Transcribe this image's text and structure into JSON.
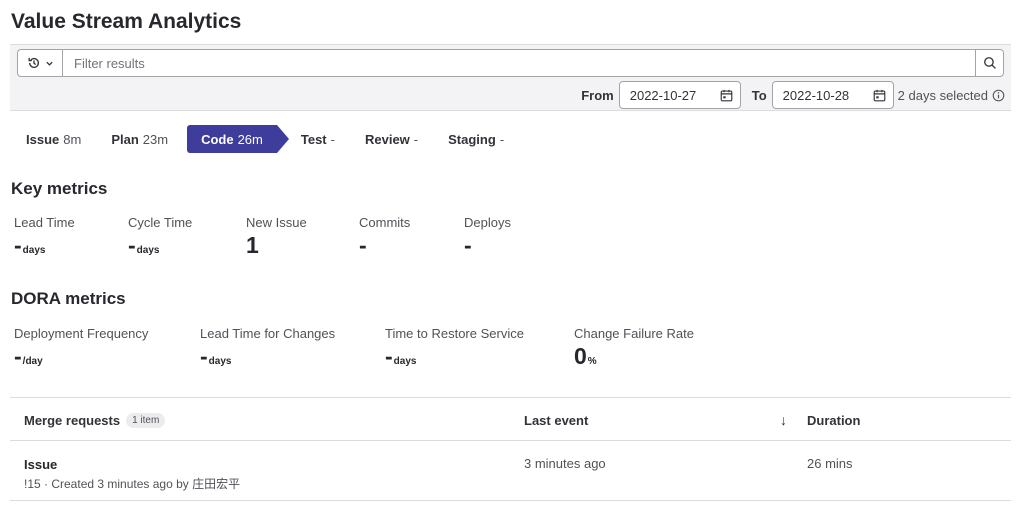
{
  "page": {
    "title": "Value Stream Analytics"
  },
  "filter": {
    "placeholder": "Filter results",
    "from_label": "From",
    "from_value": "2022-10-27",
    "to_label": "To",
    "to_value": "2022-10-28",
    "days_selected": "2 days selected"
  },
  "stages": [
    {
      "name": "Issue",
      "value": "8m"
    },
    {
      "name": "Plan",
      "value": "23m"
    },
    {
      "name": "Code",
      "value": "26m"
    },
    {
      "name": "Test",
      "value": "-"
    },
    {
      "name": "Review",
      "value": "-"
    },
    {
      "name": "Staging",
      "value": "-"
    }
  ],
  "key_metrics": {
    "title": "Key metrics",
    "items": [
      {
        "label": "Lead Time",
        "value": "-",
        "unit": "days"
      },
      {
        "label": "Cycle Time",
        "value": "-",
        "unit": "days"
      },
      {
        "label": "New Issue",
        "value": "1",
        "unit": ""
      },
      {
        "label": "Commits",
        "value": "-",
        "unit": ""
      },
      {
        "label": "Deploys",
        "value": "-",
        "unit": ""
      }
    ]
  },
  "dora_metrics": {
    "title": "DORA metrics",
    "items": [
      {
        "label": "Deployment Frequency",
        "value": "-",
        "unit": "/day"
      },
      {
        "label": "Lead Time for Changes",
        "value": "-",
        "unit": "days"
      },
      {
        "label": "Time to Restore Service",
        "value": "-",
        "unit": "days"
      },
      {
        "label": "Change Failure Rate",
        "value": "0",
        "unit": "%"
      }
    ]
  },
  "table": {
    "col_merge_requests": "Merge requests",
    "count_badge": "1 item",
    "col_last_event": "Last event",
    "sort_icon": "↓",
    "col_duration": "Duration",
    "rows": [
      {
        "title": "Issue",
        "subtitle": "!15 · Created 3 minutes ago by 庄田宏平",
        "last_event": "3 minutes ago",
        "duration": "26 mins"
      }
    ]
  },
  "colors": {
    "active_stage": "#3e3d9c"
  }
}
